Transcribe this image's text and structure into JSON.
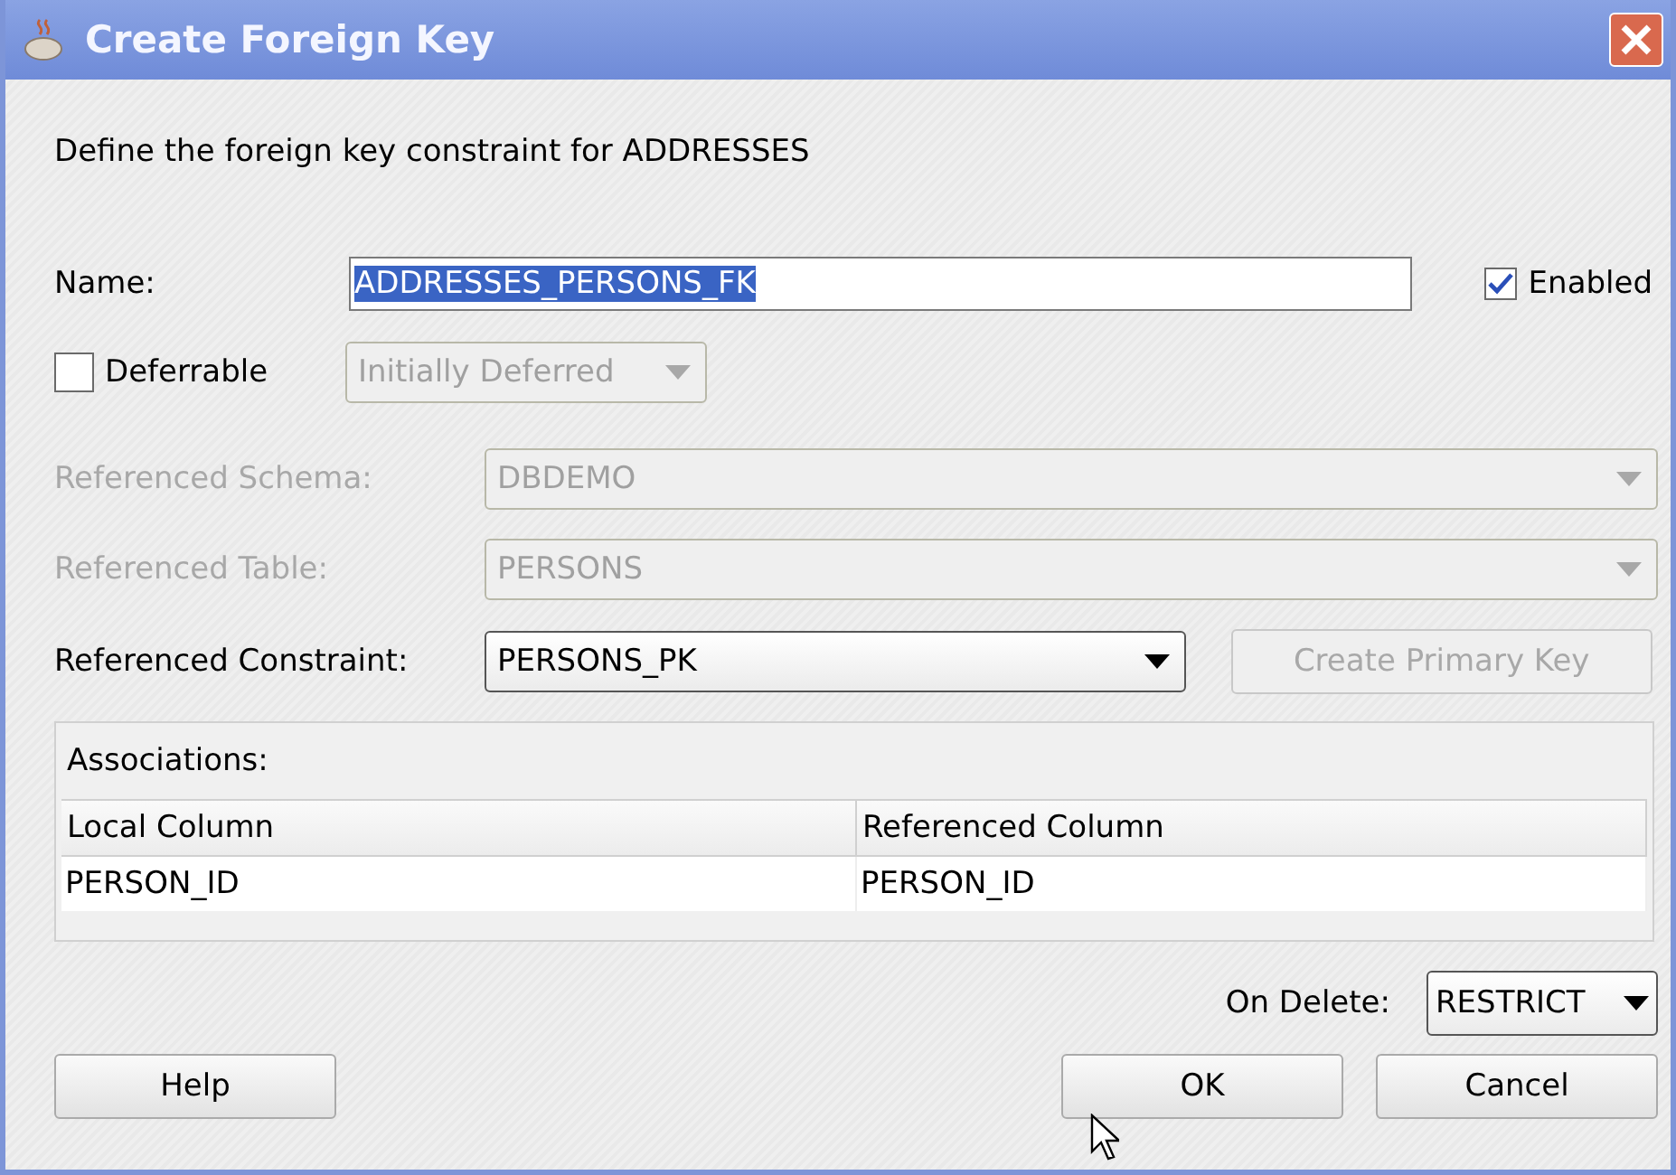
{
  "window": {
    "title": "Create Foreign Key"
  },
  "description": "Define the foreign key constraint for ADDRESSES",
  "name_field": {
    "label": "Name:",
    "value": "ADDRESSES_PERSONS_FK",
    "selected": true
  },
  "enabled": {
    "label": "Enabled",
    "checked": true
  },
  "deferrable": {
    "label": "Deferrable",
    "checked": false
  },
  "initially": {
    "value": "Initially Deferred",
    "disabled": true
  },
  "rows": [
    {
      "label": "Referenced Schema:",
      "value": "DBDEMO",
      "disabled": true
    },
    {
      "label": "Referenced Table:",
      "value": "PERSONS",
      "disabled": true
    },
    {
      "label": "Referenced Constraint:",
      "value": "PERSONS_PK",
      "disabled": false
    }
  ],
  "create_primary_key": {
    "label": "Create Primary Key",
    "disabled": true
  },
  "associations": {
    "label": "Associations:",
    "columns": [
      "Local Column",
      "Referenced Column"
    ],
    "rows": [
      [
        "PERSON_ID",
        "PERSON_ID"
      ]
    ]
  },
  "on_delete": {
    "label": "On Delete:",
    "value": "RESTRICT"
  },
  "buttons": [
    {
      "label": "Help",
      "kind": "left"
    },
    {
      "label": "OK",
      "kind": "right"
    },
    {
      "label": "Cancel",
      "kind": "right"
    }
  ]
}
